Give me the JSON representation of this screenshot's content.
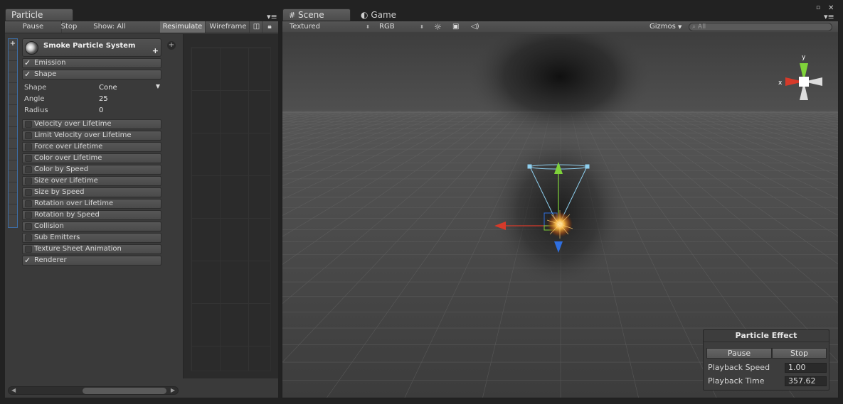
{
  "tabs": {
    "particle_effect": "Particle Effect",
    "scene": "Scene",
    "game": "Game"
  },
  "window": {
    "maximize_symbol": "▫",
    "close_symbol": "✕"
  },
  "left_toolbar": {
    "pause": "Pause",
    "stop": "Stop",
    "show": "Show: All",
    "resimulate": "Resimulate",
    "wireframe": "Wireframe"
  },
  "particle_system": {
    "name": "Smoke Particle System",
    "add_symbol": "+",
    "modules_top": [
      {
        "label": "Emission",
        "enabled": true
      },
      {
        "label": "Shape",
        "enabled": true
      }
    ],
    "shape_props": {
      "shape": {
        "label": "Shape",
        "value": "Cone"
      },
      "angle": {
        "label": "Angle",
        "value": "25"
      },
      "radius": {
        "label": "Radius",
        "value": "0"
      }
    },
    "modules": [
      {
        "label": "Velocity over Lifetime",
        "enabled": false
      },
      {
        "label": "Limit Velocity over Lifetime",
        "enabled": false
      },
      {
        "label": "Force over Lifetime",
        "enabled": false
      },
      {
        "label": "Color over Lifetime",
        "enabled": false
      },
      {
        "label": "Color by Speed",
        "enabled": false
      },
      {
        "label": "Size over Lifetime",
        "enabled": false
      },
      {
        "label": "Size by Speed",
        "enabled": false
      },
      {
        "label": "Rotation over Lifetime",
        "enabled": false
      },
      {
        "label": "Rotation by Speed",
        "enabled": false
      },
      {
        "label": "Collision",
        "enabled": false
      },
      {
        "label": "Sub Emitters",
        "enabled": false
      },
      {
        "label": "Texture Sheet Animation",
        "enabled": false
      },
      {
        "label": "Renderer",
        "enabled": true
      }
    ]
  },
  "scene_toolbar": {
    "draw_mode": "Textured",
    "render_mode": "RGB",
    "gizmos": "Gizmos",
    "search_placeholder": "All"
  },
  "gizmo": {
    "x_label": "x",
    "y_label": "y"
  },
  "overlay": {
    "title": "Particle Effect",
    "pause": "Pause",
    "stop": "Stop",
    "playback_speed_label": "Playback Speed",
    "playback_speed_value": "1.00",
    "playback_time_label": "Playback Time",
    "playback_time_value": "357.62"
  },
  "colors": {
    "axis_x": "#d63a2a",
    "axis_y": "#7fd23a",
    "axis_z": "#2f6fe0",
    "shape_cone": "#8fd0f0"
  }
}
